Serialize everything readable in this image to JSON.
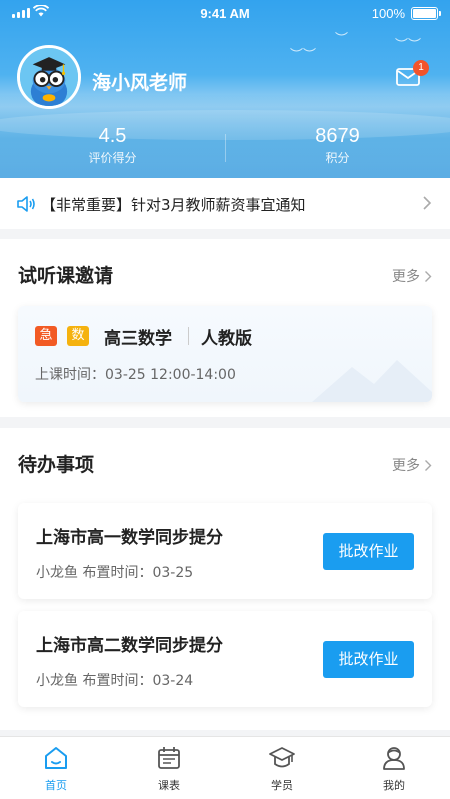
{
  "status_bar": {
    "time": "9:41 AM",
    "battery": "100%"
  },
  "profile": {
    "name": "海小风老师",
    "unread_count": "1",
    "stats": [
      {
        "value": "4.5",
        "label": "评价得分"
      },
      {
        "value": "8679",
        "label": "积分"
      }
    ]
  },
  "notice": {
    "text": "【非常重要】针对3月教师薪资事宜通知"
  },
  "trial": {
    "title": "试听课邀请",
    "more": "更多",
    "card": {
      "tags": [
        "急",
        "数"
      ],
      "course": "高三数学",
      "edition": "人教版",
      "time": "上课时间：03-25 12:00-14:00"
    }
  },
  "todo": {
    "title": "待办事项",
    "more": "更多",
    "items": [
      {
        "title": "上海市高一数学同步提分",
        "meta": "小龙鱼   布置时间：03-25",
        "action": "批改作业"
      },
      {
        "title": "上海市高二数学同步提分",
        "meta": "小龙鱼   布置时间：03-24",
        "action": "批改作业"
      }
    ]
  },
  "tabbar": {
    "items": [
      {
        "label": "首页",
        "icon": "home-icon",
        "active": true
      },
      {
        "label": "课表",
        "icon": "calendar-icon",
        "active": false
      },
      {
        "label": "学员",
        "icon": "graduation-cap-icon",
        "active": false
      },
      {
        "label": "我的",
        "icon": "user-icon",
        "active": false
      }
    ]
  },
  "colors": {
    "accent": "#1a9df0",
    "urgent_tag": "#f25a24",
    "subject_tag": "#f5b20f",
    "badge": "#f2542b"
  }
}
